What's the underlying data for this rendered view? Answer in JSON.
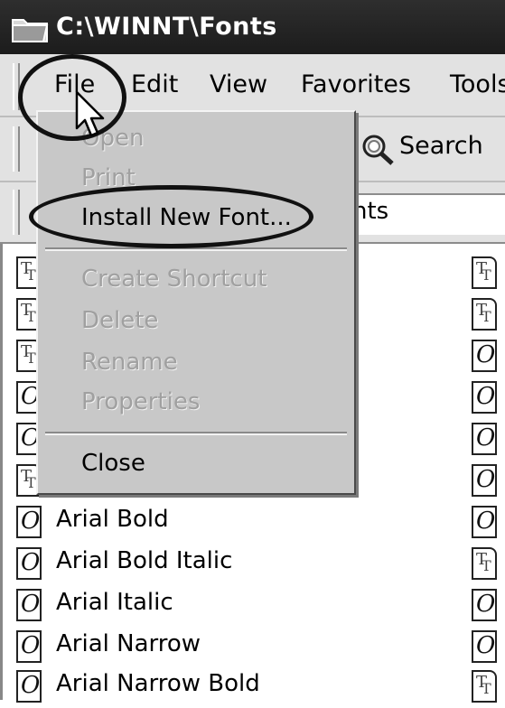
{
  "window": {
    "title": "C:\\WINNT\\Fonts"
  },
  "menubar": {
    "items": [
      "File",
      "Edit",
      "View",
      "Favorites",
      "Tools"
    ]
  },
  "toolbar": {
    "search_label": "Search"
  },
  "addressbar": {
    "value_fragment": "nts"
  },
  "file_menu": {
    "items": [
      {
        "label": "Open",
        "enabled": false
      },
      {
        "label": "Print",
        "enabled": false
      },
      {
        "label": "Install New Font...",
        "enabled": true
      },
      {
        "label": "Create Shortcut",
        "enabled": false
      },
      {
        "label": "Delete",
        "enabled": false
      },
      {
        "label": "Rename",
        "enabled": false
      },
      {
        "label": "Properties",
        "enabled": false
      },
      {
        "label": "Close",
        "enabled": true
      }
    ]
  },
  "font_list": {
    "visible_names": [
      "Arial Bold",
      "Arial Bold Italic",
      "Arial Italic",
      "Arial Narrow",
      "Arial Narrow Bold"
    ]
  },
  "icons": {
    "folder": "folder-icon",
    "search": "search-magnifier-icon",
    "opentype": "opentype-font-icon",
    "truetype": "truetype-font-icon",
    "cursor": "mouse-pointer-icon"
  },
  "colors": {
    "titlebar": "#1c1c1c",
    "menu_bg": "#c8c8c8",
    "disabled_text": "#a0a0a0"
  }
}
